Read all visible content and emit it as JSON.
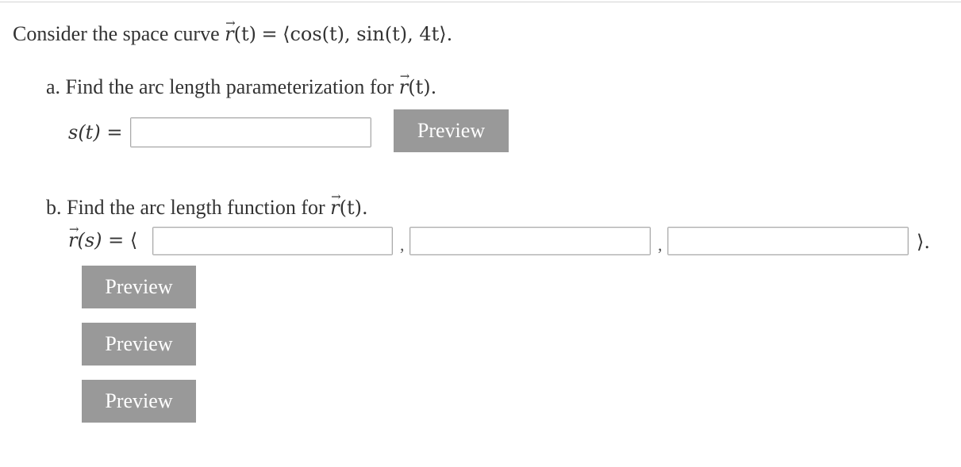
{
  "problem": {
    "intro": "Consider the space curve",
    "r_symbol": "r",
    "t_arg": "(t)",
    "equals": "=",
    "definition": "⟨cos(t), sin(t), 4t⟩."
  },
  "part_a": {
    "prefix": "a. Find the arc length parameterization for",
    "r_symbol": "r",
    "suffix": "(t).",
    "answer_label": "s(t) =",
    "answer_value": "",
    "preview_label": "Preview"
  },
  "part_b": {
    "prefix": "b. Find the arc length function for",
    "r_symbol": "r",
    "suffix": "(t).",
    "answer_lhs_r": "r",
    "answer_lhs_arg": "(s)",
    "answer_equals": "= ⟨",
    "separator_1": ",",
    "separator_2": ",",
    "closing": "⟩.",
    "component_1_value": "",
    "component_2_value": "",
    "component_3_value": "",
    "preview_1_label": "Preview",
    "preview_2_label": "Preview",
    "preview_3_label": "Preview"
  },
  "colors": {
    "text": "#333333",
    "button_bg": "#999999",
    "button_text": "#ffffff",
    "input_border": "#aaaaaa"
  }
}
